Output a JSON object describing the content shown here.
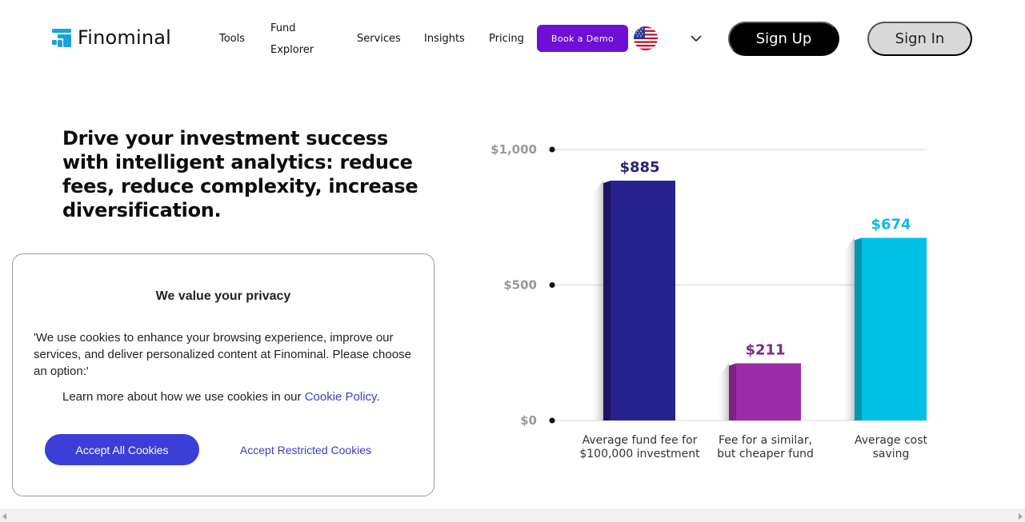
{
  "header": {
    "logo_text": "Finominal",
    "nav": {
      "tools": "Tools",
      "fund_explorer": "Fund Explorer",
      "services": "Services",
      "insights": "Insights",
      "pricing": "Pricing"
    },
    "book_demo": "Book a Demo",
    "flag_icon": "us-flag-icon",
    "sign_up": "Sign Up",
    "sign_in": "Sign In"
  },
  "hero": {
    "title": "Drive your investment success with intelligent analytics: reduce fees, reduce complexity, increase diversification."
  },
  "chart_data": {
    "type": "bar",
    "categories": [
      "Average fund fee for $100,000 investment",
      "Fee for a similar, but cheaper fund",
      "Average cost saving"
    ],
    "category_lines": [
      [
        "Average fund fee for",
        "$100,000 investment"
      ],
      [
        "Fee for a similar,",
        "but cheaper fund"
      ],
      [
        "Average cost",
        "saving"
      ]
    ],
    "values": [
      885,
      211,
      674
    ],
    "value_labels": [
      "$885",
      "$211",
      "$674"
    ],
    "colors": [
      "#26238f",
      "#9b2ba6",
      "#00c0e6"
    ],
    "side_colors": [
      "#1c1460",
      "#7a2287",
      "#0097b0"
    ],
    "label_colors": [
      "#26237a",
      "#7b2a86",
      "#14b9dc"
    ],
    "ylim": [
      0,
      1000
    ],
    "y_ticks": [
      0,
      500,
      1000
    ],
    "y_tick_labels": [
      "$0",
      "$500",
      "$1,000"
    ],
    "grid": true
  },
  "cookie": {
    "title": "We value your privacy",
    "description": "'We use cookies to enhance your browsing experience, improve our services, and deliver personalized content at Finominal. Please choose an option:'",
    "learn_more_prefix": "Learn more about how we use cookies in our ",
    "policy_link": "Cookie Policy",
    "learn_more_suffix": ".",
    "accept_all": "Accept All Cookies",
    "accept_restricted": "Accept Restricted Cookies"
  }
}
